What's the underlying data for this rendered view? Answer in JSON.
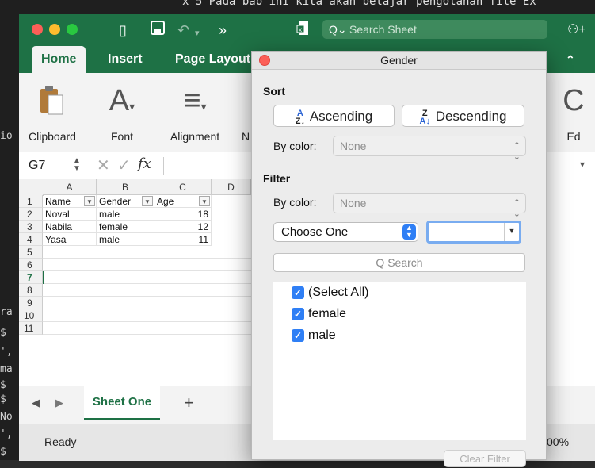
{
  "terminal": {
    "top_text": "x 5   Pada bab ini kita akan belajar pengolahan file Ex",
    "side_fragments": [
      "io",
      "ra",
      "$",
      "',",
      "ma",
      "$",
      "$",
      "No",
      "',",
      "$"
    ]
  },
  "excel": {
    "search_placeholder": "Search Sheet",
    "tabs": [
      "Home",
      "Insert",
      "Page Layout"
    ],
    "ribbon_groups": [
      "Clipboard",
      "Font",
      "Alignment",
      "N",
      "Ed"
    ],
    "name_box": "G7",
    "fx": "fx",
    "columns": [
      "A",
      "B",
      "C",
      "D"
    ],
    "row_numbers": [
      "1",
      "2",
      "3",
      "4",
      "5",
      "6",
      "7",
      "8",
      "9",
      "10",
      "11"
    ],
    "selected_row": "7",
    "header_row": [
      "Name",
      "Gender",
      "Age"
    ],
    "rows": [
      [
        "Noval",
        "male",
        "18"
      ],
      [
        "Nabila",
        "female",
        "12"
      ],
      [
        "Yasa",
        "male",
        "11"
      ]
    ],
    "sheet_tab": "Sheet One",
    "add_sheet": "+",
    "status": "Ready",
    "zoom": "00%"
  },
  "dialog": {
    "title": "Gender",
    "sort_heading": "Sort",
    "ascending_label": "Ascending",
    "descending_label": "Descending",
    "sort_by_color_label": "By color:",
    "sort_by_color_value": "None",
    "filter_heading": "Filter",
    "filter_by_color_label": "By color:",
    "filter_by_color_value": "None",
    "condition_value": "Choose One",
    "search_placeholder": "Search",
    "items": [
      "(Select All)",
      "female",
      "male"
    ],
    "clear_filter_label": "Clear Filter"
  },
  "colors": {
    "excel_green": "#1e7145",
    "checkbox_blue": "#2f7ff5"
  }
}
